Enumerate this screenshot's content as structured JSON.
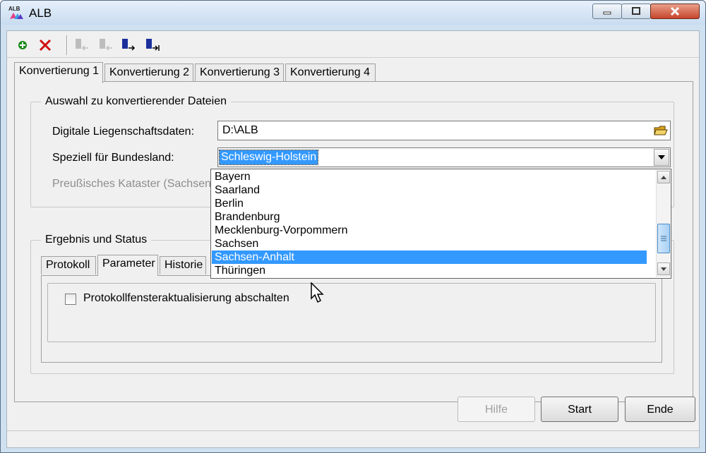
{
  "window": {
    "title": "ALB",
    "icon_text": "ALB"
  },
  "toolbar": {
    "icons": [
      "add-icon",
      "delete-icon",
      "move-left-icon",
      "move-left-alt-icon",
      "move-right-icon",
      "move-right-end-icon"
    ]
  },
  "tabs": [
    {
      "label": "Konvertierung 1",
      "active": true
    },
    {
      "label": "Konvertierung 2",
      "active": false
    },
    {
      "label": "Konvertierung 3",
      "active": false
    },
    {
      "label": "Konvertierung 4",
      "active": false
    }
  ],
  "selection_group": {
    "legend": "Auswahl zu konvertierender Dateien",
    "data_label": "Digitale Liegenschaftsdaten:",
    "data_value": "D:\\ALB",
    "state_label": "Speziell für Bundesland:",
    "state_value": "Schleswig-Holstein",
    "cadastre_label": "Preußisches Kataster (Sachsen):"
  },
  "dropdown": {
    "items": [
      "Bayern",
      "Saarland",
      "Berlin",
      "Brandenburg",
      "Mecklenburg-Vorpommern",
      "Sachsen",
      "Sachsen-Anhalt",
      "Thüringen"
    ],
    "selected": "Sachsen-Anhalt"
  },
  "result_group": {
    "legend": "Ergebnis und Status",
    "subtabs": [
      {
        "label": "Protokoll",
        "active": false
      },
      {
        "label": "Parameter",
        "active": true
      },
      {
        "label": "Historie",
        "active": false
      }
    ],
    "checkbox_label": "Protokollfensteraktualisierung abschalten",
    "checkbox_checked": false
  },
  "buttons": {
    "help": "Hilfe",
    "start": "Start",
    "end": "Ende"
  },
  "colors": {
    "selection": "#3399ff",
    "titlebar": "#c9dcf0",
    "close": "#c8452c"
  }
}
